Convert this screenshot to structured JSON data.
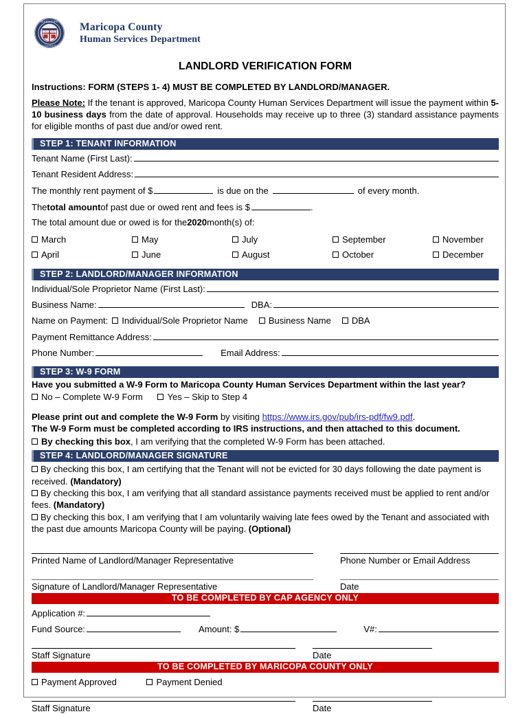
{
  "letterhead": {
    "seal_icon": "maricopa-county-seal-icon",
    "org_line1": "Maricopa County",
    "org_line2": "Human Services Department"
  },
  "title": "LANDLORD VERIFICATION FORM",
  "intro": {
    "instructions": "Instructions: FORM (STEPS 1- 4) MUST BE COMPLETED BY LANDLORD/MANAGER.",
    "note_label": "Please Note:",
    "note_part1": " If the tenant is approved, Maricopa County Human Services Department will issue the payment within ",
    "note_bold": "5-10 business days",
    "note_part2": " from the date of approval. Households may receive up to three (3) standard assistance payments for eligible months of past due and/or owed rent."
  },
  "step1": {
    "header": "STEP 1: TENANT INFORMATION",
    "tenant_name_label": "Tenant Name (First Last):",
    "tenant_address_label": "Tenant Resident Address:",
    "rent_line_a": "The monthly rent payment of $",
    "rent_line_b": "is due on the",
    "rent_line_c": "of every month.",
    "total_a": "The ",
    "total_bold": "total amount",
    "total_b": " of past due or owed rent and fees is $",
    "total_end": ".",
    "due_line_a": "The total amount due or owed is for the ",
    "due_year": "2020",
    "due_line_b": " month(s) of:",
    "months_col1": [
      "March",
      "April"
    ],
    "months_col2": [
      "May",
      "June"
    ],
    "months_col3": [
      "July",
      "August"
    ],
    "months_col4": [
      "September",
      "October"
    ],
    "months_col5": [
      "November",
      "December"
    ]
  },
  "step2": {
    "header": "STEP 2: LANDLORD/MANAGER INFORMATION",
    "proprietor_label": "Individual/Sole Proprietor Name (First Last):",
    "business_label": "Business Name:",
    "dba_label": "DBA:",
    "name_on_payment_label": "Name on Payment:",
    "payee_options": [
      "Individual/Sole Proprietor Name",
      "Business Name",
      "DBA"
    ],
    "remittance_label": "Payment Remittance Address:",
    "phone_label": "Phone Number:",
    "email_label": "Email Address:"
  },
  "step3": {
    "header": "STEP 3: W-9 FORM",
    "question": "Have you submitted a W-9 Form to Maricopa County Human Services Department within the last year?",
    "option_no": "No – Complete W-9 Form",
    "option_yes": "Yes – Skip to Step 4",
    "print_bold": "Please print out and complete the W-9 Form",
    "print_rest": " by visiting ",
    "url": "https://www.irs.gov/pub/irs-pdf/fw9.pdf",
    "url_period": ".",
    "irs_line": "The W-9 Form must be completed according to IRS instructions, and then attached to this document.",
    "attach_bold": "By checking this box",
    "attach_rest": ", I am verifying that the completed W-9 Form has been attached."
  },
  "step4": {
    "header": "STEP 4: LANDLORD/MANAGER SIGNATURE",
    "items": [
      {
        "text": "By checking this box, I am certifying that the Tenant will not be evicted for 30 days following the date payment is received. ",
        "tag": "(Mandatory)"
      },
      {
        "text": "By checking this box, I am verifying that all standard assistance payments received must be applied to rent and/or fees. ",
        "tag": "(Mandatory)"
      },
      {
        "text": "By checking this box, I am verifying that I am voluntarily waiving late fees owed by the Tenant and associated with the past due amounts Maricopa County will be paying. ",
        "tag": "(Optional)"
      }
    ],
    "printed_name_label": "Printed Name of Landlord/Manager Representative",
    "phone_email_label": "Phone Number or Email Address",
    "signature_label": "Signature of Landlord/Manager Representative",
    "date_label": "Date"
  },
  "cap": {
    "banner": "TO BE COMPLETED BY CAP AGENCY ONLY",
    "application_label": "Application #:",
    "fund_source_label": "Fund Source:",
    "amount_label": "Amount: $",
    "vnum_label": "V#:",
    "staff_signature_label": "Staff Signature",
    "date_label": "Date"
  },
  "county": {
    "banner": "TO BE COMPLETED BY MARICOPA COUNTY ONLY",
    "approved_label": "Payment Approved",
    "denied_label": "Payment Denied",
    "staff_signature_label": "Staff Signature",
    "date_label": "Date"
  },
  "colors": {
    "section_bar": "#2b3e6b",
    "red_bar": "#cc0000",
    "brand_navy": "#1f3566",
    "link_blue": "#2222cc"
  }
}
